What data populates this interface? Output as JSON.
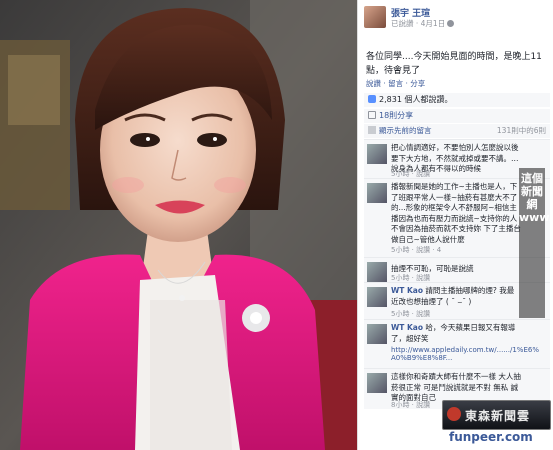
{
  "post": {
    "author": "張宇 王瑄",
    "time": "已說讚 · 4月1日",
    "text": "各位同學....今天開始見面的時間，是晚上11點，待會見了",
    "actions": "說讚 · 留言 · 分享",
    "likes": "2,831 個人都說讚。",
    "shares": "18則分享",
    "previous_comments": "顯示先前的留言",
    "comment_count": "131則中的6則"
  },
  "comments": [
    {
      "author": "",
      "text": "把心情調適好，不要怕別人怎麼說以後要下大方地，不然就戒掉或要不講。…說身為人都有不得以的時候",
      "meta": "5小時 · 說讚"
    },
    {
      "author": "",
      "text": "播報新聞是她的工作~主播也是人，下了班跟平常人一樣~抽菸有甚麼大不了的...形象的框架令人不舒服阿~相信主播因為也而有壓力而說謊~支持你的人不會因為抽菸而就不支持妳 下了主播台做自己~管他人說什麼",
      "meta": "5小時 · 說讚 · 4"
    },
    {
      "author": "",
      "text": "抽煙不可恥，可恥是說謊",
      "meta": "5小時 · 說讚"
    },
    {
      "author": "WT Kao",
      "text": "請問主播抽哪牌的煙? 我最近改也想抽煙了 ( ¯ ⌣¯ )",
      "meta": "5小時 · 說讚"
    },
    {
      "author": "WT Kao",
      "text": "哈，今天蘋果日報又有報導了，超好笑",
      "meta": "http://www.appledaily.com.tw/....../1%E6%A0%B9%E8%8F..."
    },
    {
      "author": "",
      "text": "這樣你和奇蹟大師有什麼不一樣 大人抽菸很正常 可是鬥說謊就是不對 無私 誠實的面對自己",
      "meta": "8小時 · 說讚"
    }
  ],
  "watermark": {
    "vertical": "這個新聞網www.ideal01.com",
    "logo_text": "東森新聞雲",
    "site": "funpeer.com"
  }
}
